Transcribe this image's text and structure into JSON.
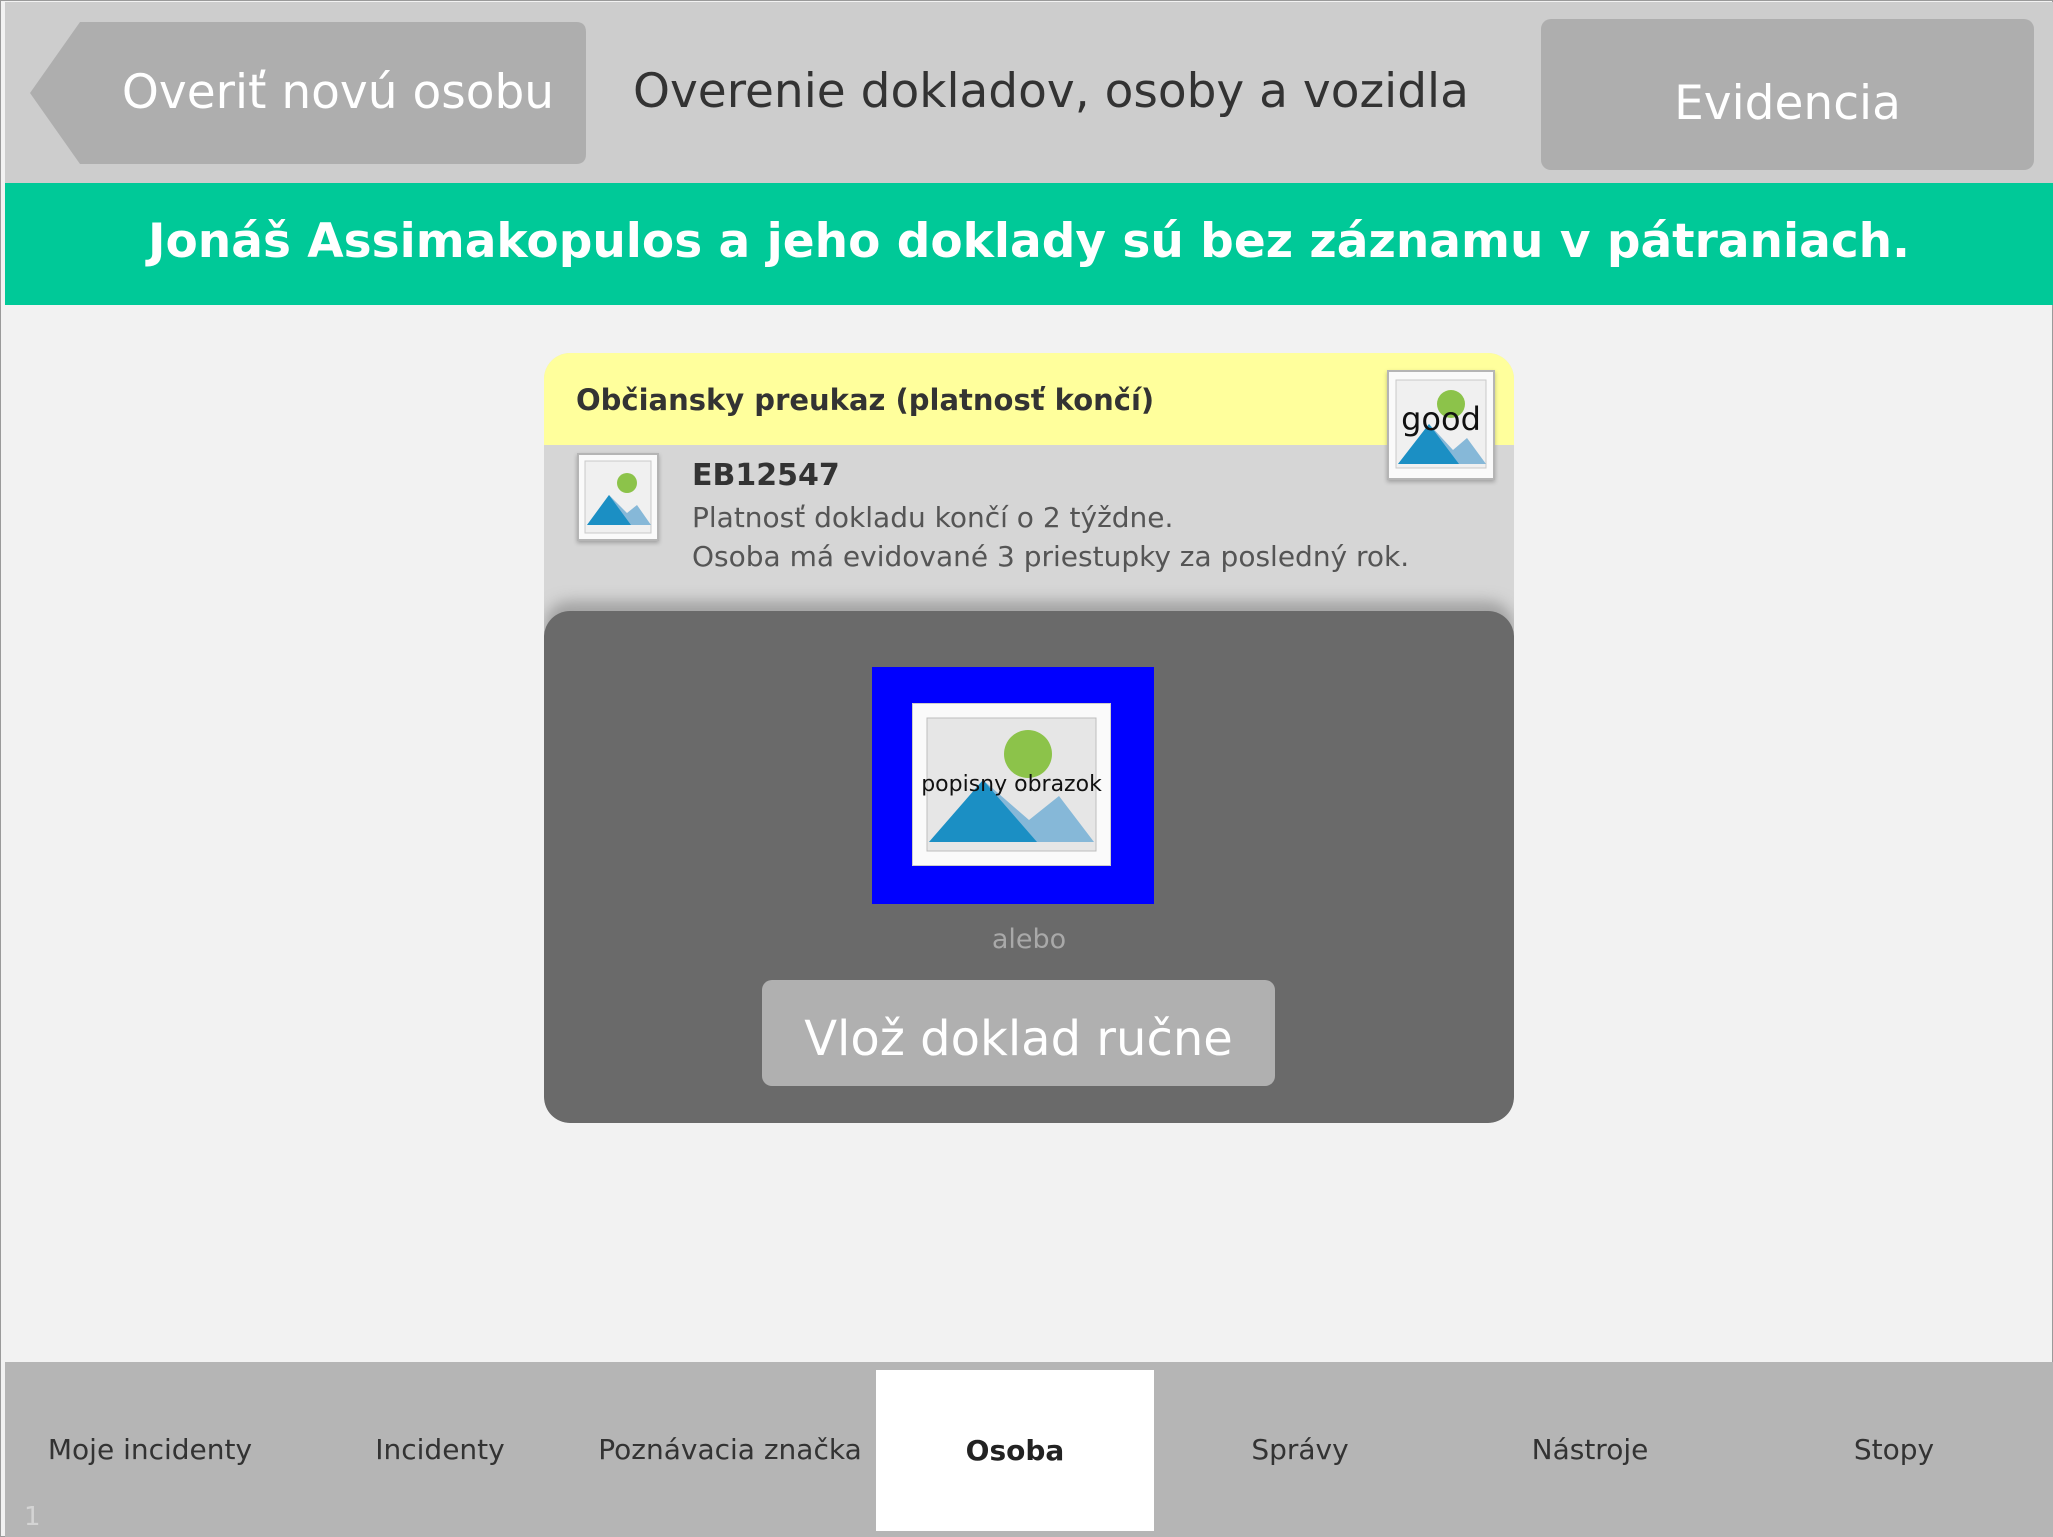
{
  "header": {
    "back_label": "Overiť novú osobu",
    "title": "Overenie dokladov, osoby a vozidla",
    "evidencia_label": "Evidencia"
  },
  "banner": {
    "text": "Jonáš Assimakopulos a jeho doklady sú bez záznamu v pátraniach."
  },
  "card": {
    "title": "Občiansky preukaz (platnosť končí)",
    "badge_label": "good",
    "doc_number": "EB12547",
    "lines": [
      "Platnosť dokladu končí o 2 týždne.",
      "Osoba má evidované 3 priestupky za posledný rok."
    ],
    "scan_label": "popisny obrazok",
    "or_label": "alebo",
    "manual_button": "Vlož doklad ručne"
  },
  "tabs": [
    {
      "label": "Moje incidenty",
      "active": false
    },
    {
      "label": "Incidenty",
      "active": false
    },
    {
      "label": "Poznávacia značka",
      "active": false
    },
    {
      "label": "Osoba",
      "active": true
    },
    {
      "label": "Správy",
      "active": false
    },
    {
      "label": "Nástroje",
      "active": false
    },
    {
      "label": "Stopy",
      "active": false
    }
  ],
  "slide_number": "1",
  "colors": {
    "banner": "#00c998",
    "card_header": "#ffff9c",
    "scan_frame": "#0000ff",
    "header_bg": "#cdcdcd",
    "tabbar_bg": "#b5b5b5"
  }
}
